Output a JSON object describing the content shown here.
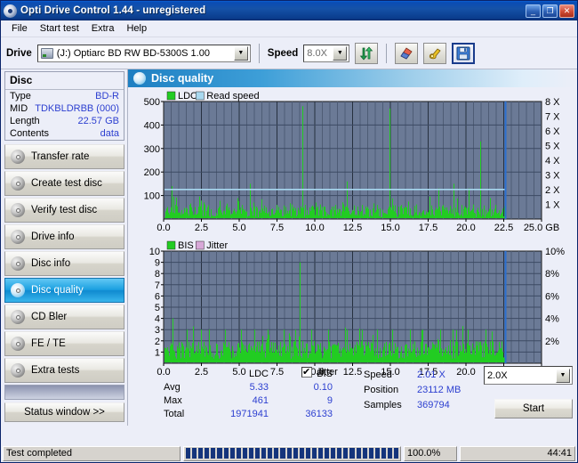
{
  "window": {
    "title": "Opti Drive Control 1.44 - unregistered",
    "app_icon": "disc-icon",
    "minimize": "_",
    "maximize": "❐",
    "close": "✕"
  },
  "menu": {
    "items": [
      "File",
      "Start test",
      "Extra",
      "Help"
    ]
  },
  "toolbar": {
    "drive_label": "Drive",
    "drive_value": "(J:)   Optiarc BD RW BD-5300S 1.00",
    "speed_label": "Speed",
    "speed_value": "8.0X",
    "dropdown_arrow": "▼",
    "buttons": [
      {
        "name": "refresh-button",
        "icon": "refresh-arrows-icon"
      },
      {
        "name": "erase-button",
        "icon": "eraser-icon"
      },
      {
        "name": "tools-button",
        "icon": "gold-tools-icon"
      },
      {
        "name": "save-button",
        "icon": "floppy-save-icon"
      }
    ]
  },
  "sidebar": {
    "disc_header": "Disc",
    "disc_rows": [
      {
        "key": "Type",
        "value": "BD-R"
      },
      {
        "key": "MID",
        "value": "TDKBLDRBB (000)"
      },
      {
        "key": "Length",
        "value": "22.57 GB"
      },
      {
        "key": "Contents",
        "value": "data"
      }
    ],
    "nav_items": [
      {
        "label": "Transfer rate",
        "selected": false
      },
      {
        "label": "Create test disc",
        "selected": false
      },
      {
        "label": "Verify test disc",
        "selected": false
      },
      {
        "label": "Drive info",
        "selected": false
      },
      {
        "label": "Disc info",
        "selected": false
      },
      {
        "label": "Disc quality",
        "selected": true
      },
      {
        "label": "CD Bler",
        "selected": false
      },
      {
        "label": "FE / TE",
        "selected": false
      },
      {
        "label": "Extra tests",
        "selected": false
      }
    ],
    "status_window_button": "Status window >>"
  },
  "main": {
    "panel_title": "Disc quality",
    "stats_headers": {
      "blank": "",
      "ldc": "LDC",
      "bis": "BIS"
    },
    "stats_rows": [
      {
        "label": "Avg",
        "ldc": "5.33",
        "bis": "0.10"
      },
      {
        "label": "Max",
        "ldc": "461",
        "bis": "9"
      },
      {
        "label": "Total",
        "ldc": "1971941",
        "bis": "36133"
      }
    ],
    "jitter_checkbox_label": "Jitter",
    "jitter_checked": true,
    "readout": [
      {
        "label": "Speed",
        "value": "2.01 X"
      },
      {
        "label": "Position",
        "value": "23112 MB"
      },
      {
        "label": "Samples",
        "value": "369794"
      }
    ],
    "speed_select_value": "2.0X",
    "start_button": "Start"
  },
  "statusbar": {
    "message": "Test completed",
    "percent": "100.0%",
    "elapsed": "44:41",
    "progress_value": 100
  },
  "colors": {
    "ldc_green": "#22cc22",
    "read_speed_blue": "#a8d8f0",
    "bis_green": "#22cc22",
    "jitter_pink": "#d8a8d8",
    "plot_bg": "#6b7a96",
    "grid": "#3c4a63",
    "cursor_blue": "#2a6fd0",
    "value_blue": "#2c3fd0",
    "accent": "#1a9fe0"
  },
  "chart_data": [
    {
      "type": "area",
      "id": "ldc-chart",
      "title": "Disc quality",
      "xlabel": "GB",
      "ylabel": "LDC",
      "legend": [
        {
          "name": "LDC",
          "color": "#22cc22"
        },
        {
          "name": "Read speed",
          "color": "#a8d8f0"
        }
      ],
      "legend_position": "top-left",
      "grid": true,
      "xlim": [
        0,
        25
      ],
      "ylim": [
        0,
        500
      ],
      "xticks": [
        "0.0",
        "2.5",
        "5.0",
        "7.5",
        "10.0",
        "12.5",
        "15.0",
        "17.5",
        "20.0",
        "22.5",
        "25.0 GB"
      ],
      "yticks": [
        100,
        200,
        300,
        400,
        500
      ],
      "y2label": "Read speed",
      "y2lim": [
        0,
        8
      ],
      "y2ticks": [
        "1 X",
        "2 X",
        "3 X",
        "4 X",
        "5 X",
        "6 X",
        "7 X",
        "8 X"
      ],
      "data_end_gb": 22.6,
      "cursor_gb": 22.6,
      "series": [
        {
          "name": "Read speed",
          "color": "#a8d8f0",
          "x": [
            0.0,
            2.0,
            5.0,
            10.0,
            15.0,
            20.0,
            22.6
          ],
          "values": [
            2.01,
            2.01,
            2.01,
            2.01,
            2.01,
            2.01,
            2.01
          ]
        },
        {
          "name": "LDC",
          "color": "#22cc22",
          "baseline_avg": 5.33,
          "x": [
            0.15,
            0.35,
            0.55,
            0.62,
            0.75,
            0.95,
            1.2,
            1.45,
            1.7,
            1.95,
            2.2,
            2.45,
            2.7,
            2.95,
            3.2,
            3.45,
            3.7,
            3.95,
            4.2,
            4.45,
            4.7,
            4.95,
            5.2,
            5.45,
            5.7,
            5.95,
            6.2,
            6.45,
            6.7,
            6.95,
            7.2,
            7.45,
            7.7,
            7.95,
            8.2,
            8.45,
            8.7,
            8.95,
            9.2,
            9.35,
            9.6,
            9.85,
            10.1,
            10.35,
            10.6,
            10.85,
            11.1,
            11.35,
            11.6,
            11.85,
            12.1,
            12.35,
            12.4,
            12.6,
            12.85,
            13.1,
            13.35,
            13.6,
            13.85,
            14.1,
            14.35,
            14.6,
            14.85,
            14.95,
            15.2,
            15.45,
            15.7,
            15.95,
            16.2,
            16.45,
            16.7,
            16.95,
            17.2,
            17.45,
            17.7,
            17.95,
            18.2,
            18.45,
            18.7,
            18.95,
            19.2,
            19.45,
            19.7,
            19.95,
            20.2,
            20.45,
            20.7,
            20.95,
            21.2,
            21.45,
            21.6,
            21.7,
            21.95,
            22.2,
            22.45,
            22.6
          ],
          "values": [
            30,
            55,
            140,
            95,
            60,
            45,
            50,
            35,
            60,
            40,
            55,
            38,
            62,
            44,
            50,
            36,
            58,
            42,
            66,
            48,
            52,
            40,
            60,
            44,
            150,
            70,
            50,
            62,
            45,
            55,
            38,
            60,
            42,
            58,
            46,
            62,
            40,
            55,
            480,
            60,
            45,
            58,
            40,
            62,
            48,
            55,
            42,
            60,
            38,
            56,
            160,
            50,
            44,
            58,
            42,
            60,
            38,
            55,
            42,
            60,
            46,
            52,
            40,
            470,
            58,
            44,
            60,
            42,
            56,
            38,
            62,
            46,
            50,
            40,
            58,
            44,
            130,
            60,
            42,
            56,
            150,
            48,
            60,
            44,
            130,
            62,
            50,
            330,
            58,
            44,
            52,
            46,
            60,
            42,
            55,
            40
          ]
        }
      ]
    },
    {
      "type": "area",
      "id": "bis-chart",
      "xlabel": "GB",
      "ylabel": "BIS",
      "legend": [
        {
          "name": "BIS",
          "color": "#22cc22"
        },
        {
          "name": "Jitter",
          "color": "#d8a8d8"
        }
      ],
      "legend_position": "top-left",
      "grid": true,
      "xlim": [
        0,
        25
      ],
      "ylim": [
        0,
        10
      ],
      "xticks": [
        "0.0",
        "2.5",
        "5.0",
        "7.5",
        "10.0",
        "12.5",
        "15.0",
        "17.5",
        "20.0",
        "22.5",
        "25.0 GB"
      ],
      "yticks": [
        1,
        2,
        3,
        4,
        5,
        6,
        7,
        8,
        9,
        10
      ],
      "y2label": "Jitter",
      "y2lim": [
        0,
        10
      ],
      "y2ticks": [
        "2%",
        "4%",
        "6%",
        "8%",
        "10%"
      ],
      "data_end_gb": 22.6,
      "cursor_gb": 22.6,
      "series": [
        {
          "name": "BIS",
          "color": "#22cc22",
          "baseline_avg": 0.1,
          "x": [
            0.15,
            0.3,
            0.45,
            0.6,
            0.65,
            0.8,
            0.95,
            1.1,
            1.25,
            1.4,
            1.55,
            1.7,
            1.85,
            2.0,
            2.15,
            2.3,
            2.45,
            2.6,
            2.75,
            2.9,
            3.0,
            3.15,
            3.3,
            3.45,
            3.6,
            3.75,
            3.9,
            4.05,
            4.2,
            4.35,
            4.5,
            4.65,
            4.8,
            4.95,
            5.1,
            5.25,
            5.4,
            5.55,
            5.7,
            5.85,
            6.0,
            6.15,
            6.3,
            6.45,
            6.6,
            6.75,
            6.9,
            7.05,
            7.2,
            7.35,
            7.5,
            7.65,
            7.8,
            7.95,
            8.1,
            8.25,
            8.4,
            8.55,
            8.7,
            8.85,
            9.0,
            9.15,
            9.3,
            9.45,
            9.6,
            9.75,
            9.9,
            10.1,
            10.3,
            10.5,
            10.7,
            10.9,
            11.1,
            11.3,
            11.5,
            11.7,
            11.9,
            12.1,
            12.3,
            12.5,
            12.7,
            12.9,
            13.1,
            13.3,
            13.5,
            13.7,
            13.9,
            14.1,
            14.3,
            14.5,
            14.7,
            14.9,
            15.1,
            15.3,
            15.5,
            15.7,
            15.9,
            16.1,
            16.3,
            16.5,
            16.7,
            16.9,
            17.1,
            17.3,
            17.5,
            17.7,
            17.9,
            18.1,
            18.3,
            18.5,
            18.7,
            18.9,
            19.1,
            19.3,
            19.5,
            19.7,
            19.9,
            20.1,
            20.3,
            20.5,
            20.7,
            20.9,
            21.1,
            21.3,
            21.5,
            21.7,
            21.9,
            22.1,
            22.3,
            22.5,
            22.6
          ],
          "values": [
            1,
            2,
            1,
            4,
            2,
            1,
            2,
            1,
            2,
            1,
            3,
            2,
            1,
            2,
            1,
            2,
            3,
            1,
            2,
            1,
            3,
            2,
            1,
            2,
            1,
            2,
            1,
            3,
            2,
            1,
            2,
            1,
            2,
            1,
            3,
            2,
            1,
            2,
            1,
            2,
            3,
            1,
            2,
            1,
            2,
            1,
            3,
            2,
            1,
            2,
            1,
            2,
            1,
            3,
            2,
            1,
            2,
            1,
            3,
            2,
            9,
            2,
            1,
            2,
            1,
            3,
            2,
            1,
            2,
            1,
            2,
            3,
            1,
            2,
            1,
            2,
            1,
            3,
            2,
            1,
            2,
            1,
            3,
            2,
            1,
            2,
            1,
            3,
            2,
            1,
            2,
            1,
            3,
            2,
            1,
            2,
            1,
            2,
            3,
            1,
            2,
            1,
            3,
            2,
            1,
            2,
            1,
            2,
            3,
            1,
            2,
            1,
            3,
            2,
            1,
            2,
            1,
            3,
            2,
            1,
            2,
            1,
            2,
            3,
            1,
            2,
            1,
            2,
            1,
            2,
            1
          ]
        },
        {
          "name": "Jitter",
          "color": "#d8a8d8",
          "x": [],
          "values": []
        }
      ]
    }
  ]
}
